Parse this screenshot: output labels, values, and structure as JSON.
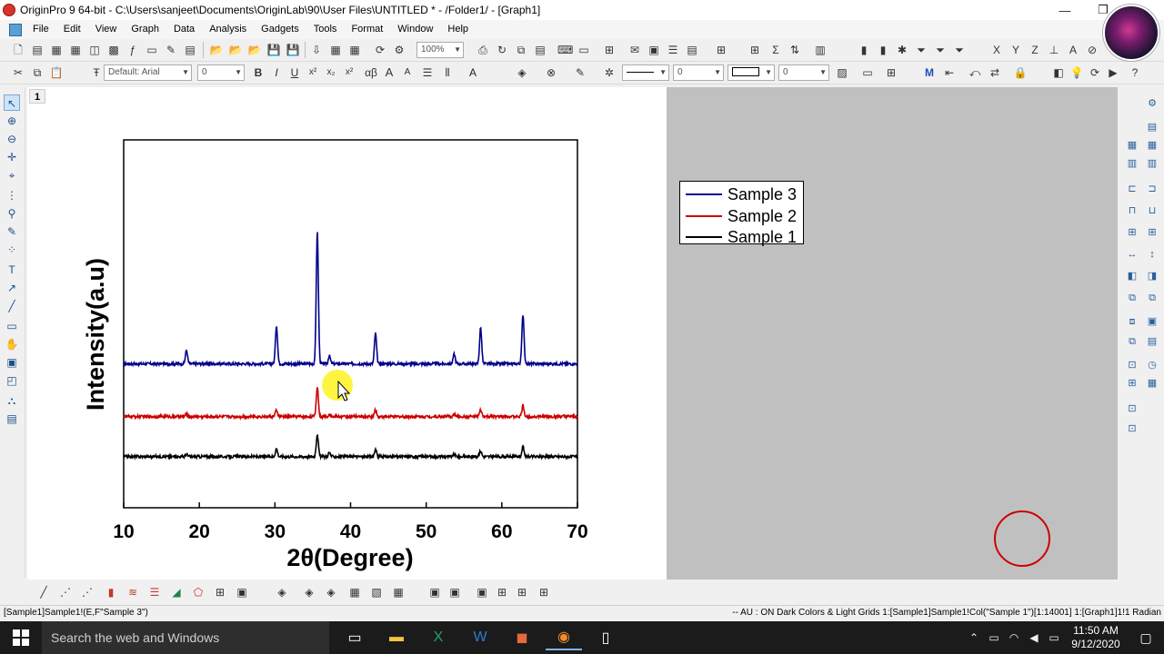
{
  "window": {
    "title": "OriginPro 9 64-bit - C:\\Users\\sanjeet\\Documents\\OriginLab\\90\\User Files\\UNTITLED * - /Folder1/ - [Graph1]",
    "minimize": "—",
    "maximize": "❐",
    "close": "✕"
  },
  "menu": [
    "File",
    "Edit",
    "View",
    "Graph",
    "Data",
    "Analysis",
    "Gadgets",
    "Tools",
    "Format",
    "Window",
    "Help"
  ],
  "toolbar": {
    "zoom": "100%",
    "font": "Default: Arial",
    "font_size": "0",
    "line_width": "0",
    "line_size": "0",
    "bold": "B",
    "italic": "I",
    "underline": "U",
    "superscript": "x²",
    "subscript": "x₂",
    "greek": "αβ",
    "grow_font": "A",
    "shrink_font": "A"
  },
  "graph": {
    "layer_number": "1",
    "chart_data": {
      "type": "line",
      "title": "",
      "xlabel": "2θ(Degree)",
      "ylabel": "Intensity(a.u)",
      "xlim": [
        10,
        70
      ],
      "xticks": [
        "10",
        "20",
        "30",
        "40",
        "50",
        "60",
        "70"
      ],
      "yticks_shown": false,
      "legend_position": "top-right, outside plot",
      "colors": {
        "Sample 3": "#00008b",
        "Sample 2": "#cc0000",
        "Sample 1": "#000000"
      },
      "series": [
        {
          "name": "Sample 3",
          "baseline": 1.8,
          "peaks": [
            [
              18.3,
              0.17
            ],
            [
              30.2,
              0.48
            ],
            [
              35.6,
              1.65
            ],
            [
              37.2,
              0.1
            ],
            [
              43.3,
              0.38
            ],
            [
              53.7,
              0.12
            ],
            [
              57.2,
              0.45
            ],
            [
              62.8,
              0.62
            ]
          ]
        },
        {
          "name": "Sample 2",
          "baseline": 1.14,
          "peaks": [
            [
              18.3,
              0.03
            ],
            [
              30.2,
              0.08
            ],
            [
              35.6,
              0.37
            ],
            [
              37.2,
              0.03
            ],
            [
              43.3,
              0.08
            ],
            [
              53.7,
              0.03
            ],
            [
              57.2,
              0.08
            ],
            [
              62.8,
              0.14
            ]
          ]
        },
        {
          "name": "Sample 1",
          "baseline": 0.64,
          "peaks": [
            [
              18.3,
              0.03
            ],
            [
              30.2,
              0.1
            ],
            [
              35.6,
              0.28
            ],
            [
              37.2,
              0.05
            ],
            [
              43.3,
              0.08
            ],
            [
              53.7,
              0.03
            ],
            [
              57.2,
              0.07
            ],
            [
              62.8,
              0.12
            ]
          ]
        }
      ]
    },
    "legend": [
      {
        "label": "Sample 3",
        "color": "#00008b"
      },
      {
        "label": "Sample 2",
        "color": "#cc0000"
      },
      {
        "label": "Sample 1",
        "color": "#000000"
      }
    ]
  },
  "status": {
    "left": "[Sample1]Sample1!(E,F\"Sample 3\")",
    "right": "-- AU : ON  Dark Colors & Light Grids  1:[Sample1]Sample1!Col(\"Sample 1\")[1:14001]  1:[Graph1]1!1  Radian"
  },
  "taskbar": {
    "search_placeholder": "Search the web and Windows",
    "time": "11:50 AM",
    "date": "9/12/2020",
    "apps": [
      "task-view",
      "file-explorer",
      "excel",
      "word",
      "paint",
      "orange-app",
      "document"
    ]
  }
}
